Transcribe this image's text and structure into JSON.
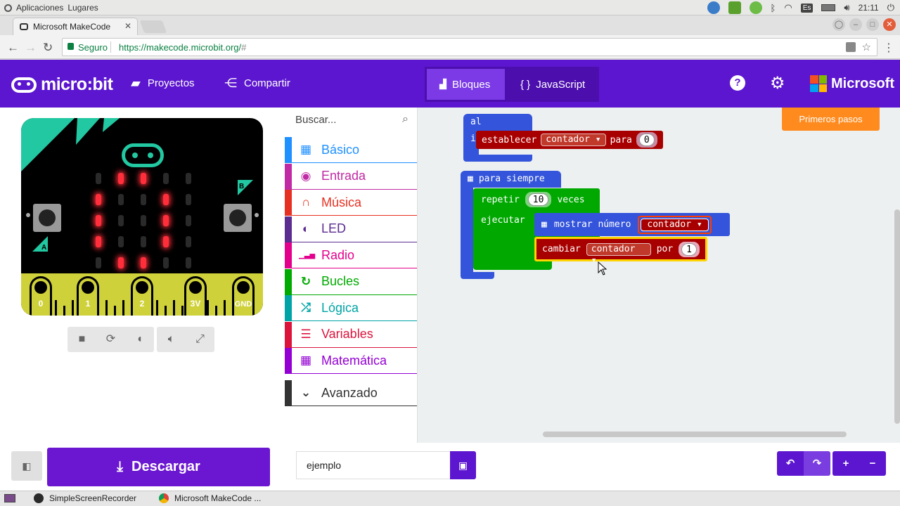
{
  "os_panel": {
    "apps": "Aplicaciones",
    "places": "Lugares",
    "keyboard": "Es",
    "time": "21:11"
  },
  "browser": {
    "tab_title": "Microsoft MakeCode",
    "secure_label": "Seguro",
    "url_main": "https://makecode.microbit.org/",
    "url_hash": "#"
  },
  "header": {
    "logo_text": "micro:bit",
    "projects_label": "Proyectos",
    "share_label": "Compartir",
    "blocks_label": "Bloques",
    "javascript_label": "JavaScript",
    "ms_label": "Microsoft",
    "ms_colors": [
      "#f25022",
      "#7fba00",
      "#00a4ef",
      "#ffb900"
    ]
  },
  "simulator": {
    "pin_labels": [
      "0",
      "1",
      "2",
      "3V",
      "GND"
    ],
    "button_a": "A",
    "button_b": "B"
  },
  "toolbox": {
    "search_placeholder": "Buscar...",
    "categories": [
      {
        "label": "Básico",
        "color": "#1e90ff",
        "icon": "grid"
      },
      {
        "label": "Entrada",
        "color": "#c02aa4",
        "icon": "target"
      },
      {
        "label": "Música",
        "color": "#e63022",
        "icon": "headphones"
      },
      {
        "label": "LED",
        "color": "#5c2d91",
        "icon": "toggle"
      },
      {
        "label": "Radio",
        "color": "#e3008c",
        "icon": "signal"
      },
      {
        "label": "Bucles",
        "color": "#00aa00",
        "icon": "refresh"
      },
      {
        "label": "Lógica",
        "color": "#00a4a6",
        "icon": "shuffle"
      },
      {
        "label": "Variables",
        "color": "#dc143c",
        "icon": "lines"
      },
      {
        "label": "Matemática",
        "color": "#9400d3",
        "icon": "calculator"
      }
    ],
    "advanced_label": "Avanzado"
  },
  "workspace": {
    "getting_started": "Primeros pasos",
    "on_start": "al iniciar",
    "set_kw": "establecer",
    "set_var": "contador",
    "set_to": "para",
    "set_value": "0",
    "forever": "para siempre",
    "repeat_kw": "repetir",
    "repeat_count": "10",
    "repeat_times": "veces",
    "do_kw": "ejecutar",
    "show_number": "mostrar número",
    "show_var": "contador",
    "change_kw": "cambiar",
    "change_var": "contador",
    "change_by": "por",
    "change_value": "1"
  },
  "bottom": {
    "download_label": "Descargar",
    "project_name": "ejemplo"
  },
  "taskbar": {
    "item1": "SimpleScreenRecorder",
    "item2": "Microsoft MakeCode ..."
  }
}
